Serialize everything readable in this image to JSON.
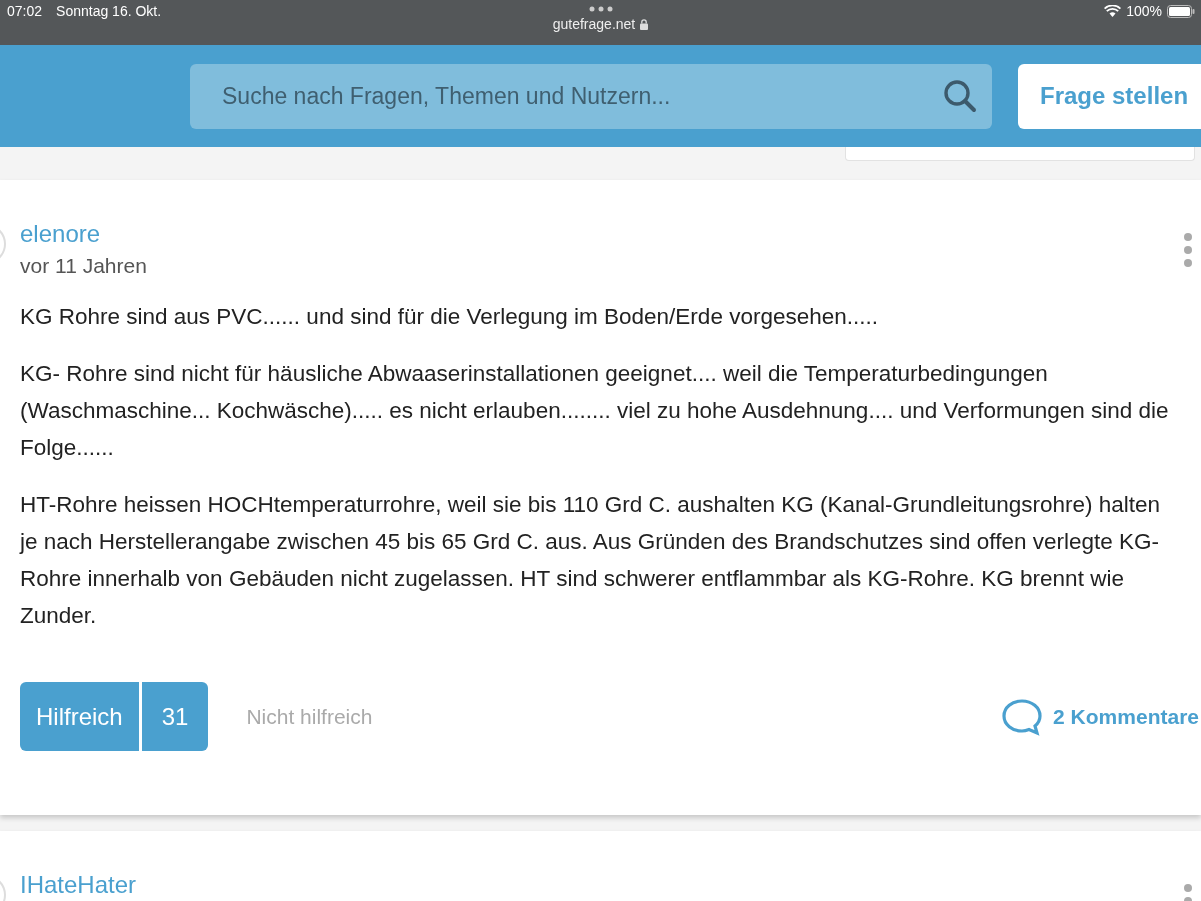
{
  "status_bar": {
    "time": "07:02",
    "date": "Sonntag 16. Okt.",
    "url": "gutefrage.net",
    "battery": "100%"
  },
  "header": {
    "search": {
      "placeholder": "Suche nach Fragen, Themen und Nutzern..."
    },
    "ask_button": "Frage stellen"
  },
  "answers": [
    {
      "author": "elenore",
      "age": "vor 11 Jahren",
      "paragraphs": [
        "KG Rohre sind aus PVC...... und sind für die Verlegung im Boden/Erde vorgesehen.....",
        "KG- Rohre sind nicht für häusliche Abwaaserinstallationen geeignet.... weil die Temperaturbedingungen (Waschmaschine... Kochwäsche)..... es nicht erlauben........ viel zu hohe Ausdehnung.... und Verformungen sind die Folge......",
        "HT-Rohre heissen HOCHtemperaturrohre, weil sie bis 110 Grd C. aushalten KG (Kanal-Grundleitungsrohre) halten je nach Herstellerangabe zwischen 45 bis 65 Grd C. aus. Aus Gründen des Brandschutzes sind offen verlegte KG-Rohre innerhalb von Gebäuden nicht zugelassen. HT sind schwerer entflammbar als KG-Rohre. KG brennt wie Zunder."
      ],
      "helpful": "Hilfreich",
      "helpful_count": "31",
      "not_helpful": "Nicht hilfreich",
      "comments": "2 Kommentare"
    },
    {
      "author": "IHateHater"
    }
  ]
}
